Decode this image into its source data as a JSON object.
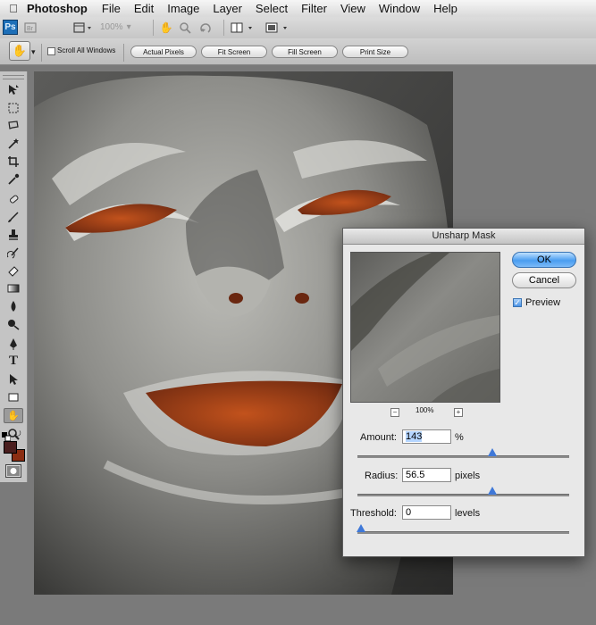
{
  "menubar": {
    "app_name": "Photoshop",
    "items": [
      "File",
      "Edit",
      "Image",
      "Layer",
      "Select",
      "Filter",
      "View",
      "Window",
      "Help"
    ]
  },
  "app_bar": {
    "logo": "Ps",
    "zoom_value": "100%",
    "icons": [
      "bridge-icon",
      "view-extras-icon",
      "hand-icon",
      "zoom-icon",
      "rotate-icon",
      "arrange-icon",
      "screen-mode-icon"
    ]
  },
  "options_bar": {
    "scroll_all_windows": "Scroll All Windows",
    "scroll_all_checked": false,
    "buttons": [
      "Actual Pixels",
      "Fit Screen",
      "Fill Screen",
      "Print Size"
    ]
  },
  "colors": {
    "foreground": "#4a1e1e",
    "background": "#8b2d12",
    "accent": "#3f78d8"
  },
  "dialog": {
    "title": "Unsharp Mask",
    "ok_label": "OK",
    "cancel_label": "Cancel",
    "preview_label": "Preview",
    "preview_checked": true,
    "zoom_minus": "−",
    "zoom_level": "100%",
    "zoom_plus": "+",
    "amount": {
      "label": "Amount:",
      "value": "143",
      "unit": "%",
      "slider_fraction": 0.62
    },
    "radius": {
      "label": "Radius:",
      "value": "56.5",
      "unit": "pixels",
      "slider_fraction": 0.62
    },
    "threshold": {
      "label": "Threshold:",
      "value": "0",
      "unit": "levels",
      "slider_fraction": 0.0
    }
  }
}
